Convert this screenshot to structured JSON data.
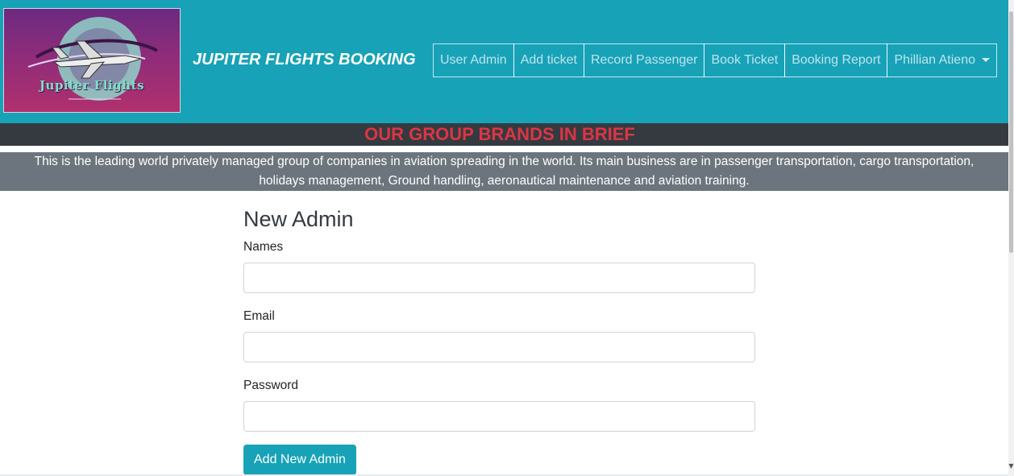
{
  "header": {
    "logo_text": "Jupiter Flights",
    "brand_title": "JUPITER FLIGHTS BOOKING",
    "colors": {
      "header_bg": "#17a2b8",
      "logo_bg": "#8e2c7a"
    }
  },
  "nav": {
    "items": [
      {
        "label": "User Admin"
      },
      {
        "label": "Add ticket"
      },
      {
        "label": "Record Passenger"
      },
      {
        "label": "Book Ticket"
      },
      {
        "label": "Booking Report"
      }
    ],
    "user_menu": {
      "label": "Phillian Atieno",
      "icon": "caret-down-icon"
    }
  },
  "brief": {
    "title": "OUR GROUP BRANDS IN BRIEF",
    "text": "This is the leading world privately managed group of companies in aviation spreading in the world. Its main business are in passenger transportation, cargo transportation, holidays management, Ground handling, aeronautical maintenance and aviation training.",
    "colors": {
      "title": "#dc3545",
      "bar_bg": "#343a40",
      "box_bg": "#6c757d"
    }
  },
  "form": {
    "title": "New Admin",
    "fields": [
      {
        "label": "Names",
        "value": "",
        "placeholder": ""
      },
      {
        "label": "Email",
        "value": "",
        "placeholder": ""
      },
      {
        "label": "Password",
        "value": "",
        "placeholder": ""
      }
    ],
    "submit_label": "Add New Admin"
  }
}
